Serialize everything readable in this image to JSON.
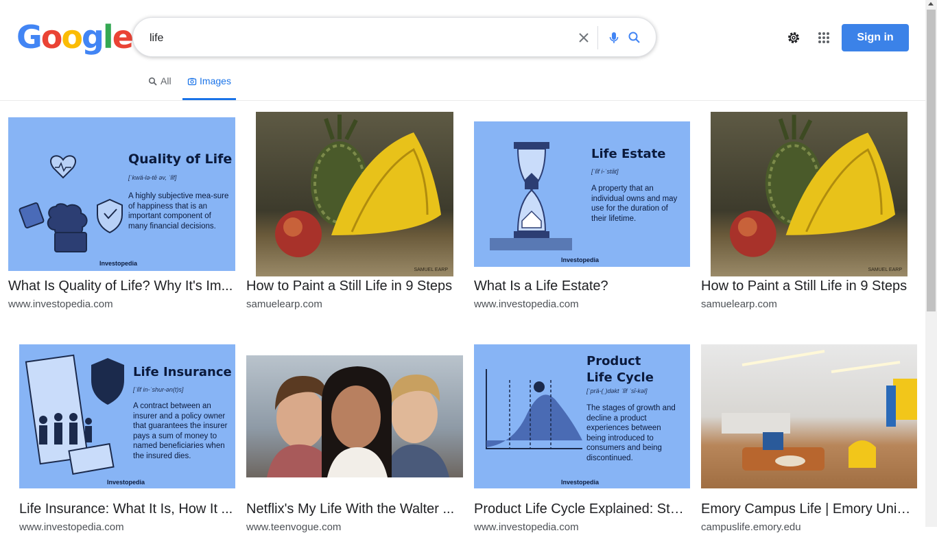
{
  "header": {
    "logo_letters": [
      "G",
      "o",
      "o",
      "g",
      "l",
      "e"
    ],
    "logo_colors": [
      "#4285F4",
      "#EA4335",
      "#FBBC05",
      "#4285F4",
      "#34A853",
      "#EA4335"
    ],
    "search_query": "life",
    "signin_label": "Sign in",
    "icons": [
      "close-icon",
      "mic-icon",
      "search-icon",
      "gear-icon",
      "apps-grid-icon"
    ]
  },
  "tabs": [
    {
      "label": "All",
      "icon": "search-icon",
      "active": false
    },
    {
      "label": "Images",
      "icon": "image-icon",
      "active": true
    }
  ],
  "results": [
    {
      "title": "What Is Quality of Life? Why It's Im...",
      "source": "www.investopedia.com",
      "image": {
        "kind": "infographic",
        "heading": "Quality of Life",
        "pron": "[ˈkwä-lə-tē əv, ˈlīf]",
        "body": "A highly subjective mea-sure of happiness that is an important component of many financial decisions.",
        "brand": "Investopedia"
      }
    },
    {
      "title": "How to Paint a Still Life in 9 Steps",
      "source": "samuelearp.com",
      "image": {
        "kind": "painting",
        "signature": "SAMUEL EARP"
      }
    },
    {
      "title": "What Is a Life Estate?",
      "source": "www.investopedia.com",
      "image": {
        "kind": "infographic",
        "heading": "Life Estate",
        "pron": "[ˈlīf i-ˈstāt]",
        "body": "A property that an individual owns and may use for the duration of their lifetime.",
        "brand": "Investopedia"
      }
    },
    {
      "title": "How to Paint a Still Life in 9 Steps",
      "source": "samuelearp.com",
      "image": {
        "kind": "painting",
        "signature": "SAMUEL EARP"
      }
    },
    {
      "title": "Life Insurance: What It Is, How It ...",
      "source": "www.investopedia.com",
      "image": {
        "kind": "infographic",
        "heading": "Life Insurance",
        "pron": "[ˈlīf in-ˈshur-ən(t)s]",
        "body": "A contract between an insurer and a policy owner that guarantees the insurer pays a sum of money to named beneficiaries when the insured dies.",
        "brand": "Investopedia"
      }
    },
    {
      "title": "Netflix's My Life With the Walter ...",
      "source": "www.teenvogue.com",
      "image": {
        "kind": "photo-people"
      }
    },
    {
      "title": "Product Life Cycle Explained: Stag...",
      "source": "www.investopedia.com",
      "image": {
        "kind": "infographic",
        "heading": "Product Life Cycle",
        "pron": "[ˈprä-(ˌ)dəkt ˈlīf ˈsī-kəl]",
        "body": "The stages of growth and decline a product experiences between being introduced to consumers and being discontinued.",
        "brand": "Investopedia"
      }
    },
    {
      "title": "Emory Campus Life | Emory Unive...",
      "source": "campuslife.emory.edu",
      "image": {
        "kind": "photo-lounge"
      }
    }
  ],
  "colors": {
    "accent": "#1a73e8",
    "signin": "#3b82e8",
    "infographic_bg": "#87b4f5"
  }
}
